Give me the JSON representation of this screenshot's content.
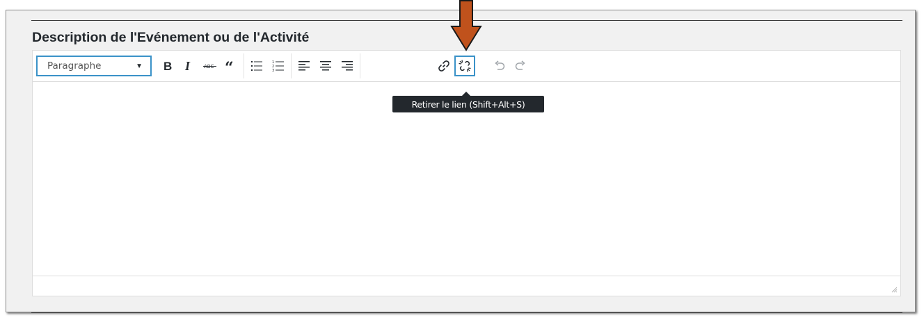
{
  "field": {
    "label": "Description de l'Evénement ou de l'Activité"
  },
  "toolbar": {
    "format_select": {
      "selected": "Paragraphe"
    },
    "buttons": [
      {
        "name": "bold-button",
        "icon": "bold-icon",
        "tooltip": ""
      },
      {
        "name": "italic-button",
        "icon": "italic-icon",
        "tooltip": ""
      },
      {
        "name": "strikethrough-button",
        "icon": "strikethrough-icon",
        "tooltip": ""
      },
      {
        "name": "blockquote-button",
        "icon": "quote-icon",
        "tooltip": ""
      },
      {
        "name": "bulleted-list-button",
        "icon": "bulleted-list-icon",
        "tooltip": ""
      },
      {
        "name": "numbered-list-button",
        "icon": "numbered-list-icon",
        "tooltip": ""
      },
      {
        "name": "align-left-button",
        "icon": "align-left-icon",
        "tooltip": ""
      },
      {
        "name": "align-center-button",
        "icon": "align-center-icon",
        "tooltip": ""
      },
      {
        "name": "align-right-button",
        "icon": "align-right-icon",
        "tooltip": ""
      },
      {
        "name": "insert-link-button",
        "icon": "link-icon",
        "tooltip": ""
      },
      {
        "name": "remove-link-button",
        "icon": "unlink-icon",
        "tooltip": "Retirer le lien (Shift+Alt+S)",
        "active": true
      },
      {
        "name": "undo-button",
        "icon": "undo-icon",
        "tooltip": ""
      },
      {
        "name": "redo-button",
        "icon": "redo-icon",
        "tooltip": ""
      }
    ]
  },
  "tooltip": {
    "text": "Retirer le lien (Shift+Alt+S)"
  },
  "colors": {
    "accent": "#3a92c8",
    "callout_arrow": "#c0521c",
    "tooltip_bg": "#23282d",
    "icon": "#23282d",
    "icon_disabled": "#a0a5aa"
  }
}
